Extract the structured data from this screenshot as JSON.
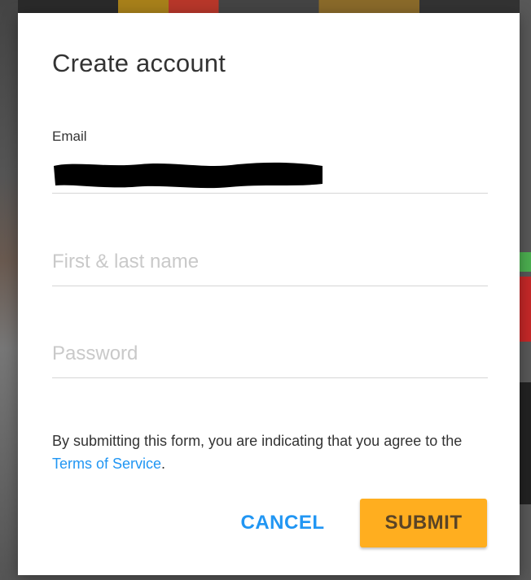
{
  "dialog": {
    "title": "Create account",
    "email": {
      "label": "Email",
      "value_redacted": true
    },
    "name": {
      "placeholder": "First & last name",
      "value": ""
    },
    "password": {
      "placeholder": "Password",
      "value": ""
    },
    "disclaimer": {
      "prefix": "By submitting this form, you are indicating that you agree to the ",
      "link": "Terms of Service",
      "suffix": "."
    },
    "cancel_label": "CANCEL",
    "submit_label": "SUBMIT"
  },
  "colors": {
    "accent_link": "#2196f3",
    "submit_bg": "#ffae1f",
    "submit_text": "#5a4426",
    "title_text": "#333333",
    "placeholder": "#c9c9c9",
    "divider": "#d6d6d6"
  }
}
